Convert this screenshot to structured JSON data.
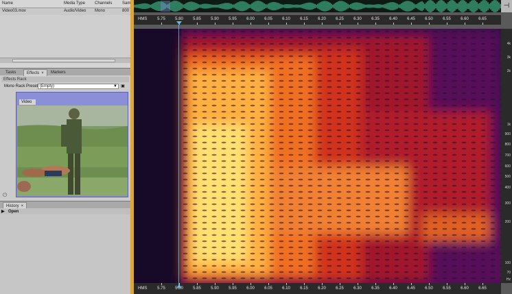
{
  "files": {
    "columns": [
      "Name",
      "Media Type",
      "Channels",
      "Sam"
    ],
    "rows": [
      {
        "name": "Video03.mov",
        "media_type": "Audio/Video",
        "channels": "Mono",
        "sample": "800"
      }
    ]
  },
  "tabs_effects": [
    {
      "label": "Tasks"
    },
    {
      "label": "Effects"
    },
    {
      "label": "Markers"
    }
  ],
  "effects_rack": {
    "title": "Effects Rack",
    "preset_label": "Mono Rack Preset:",
    "preset_value": "(Empty)"
  },
  "video": {
    "tab_label": "Video"
  },
  "history": {
    "tab_label": "History",
    "items": [
      "Open"
    ]
  },
  "timeline": {
    "format_label": "HMS",
    "ticks": [
      "5.75",
      "5.80",
      "5.85",
      "5.90",
      "5.95",
      "6.00",
      "6.05",
      "6.10",
      "6.15",
      "6.20",
      "6.25",
      "6.30",
      "6.35",
      "6.40",
      "6.45",
      "6.50",
      "6.55",
      "6.60",
      "6.65"
    ]
  },
  "frequency_axis": {
    "labels": [
      "4k",
      "3k",
      "2k",
      "1k",
      "900",
      "800",
      "700",
      "600",
      "500",
      "400",
      "300",
      "200",
      "100",
      "70",
      "Hz"
    ]
  },
  "colors": {
    "accent_orange": "#d9a640",
    "spectrogram_dark": "#1a0a2a",
    "spectrogram_hot": "#ffe070"
  }
}
